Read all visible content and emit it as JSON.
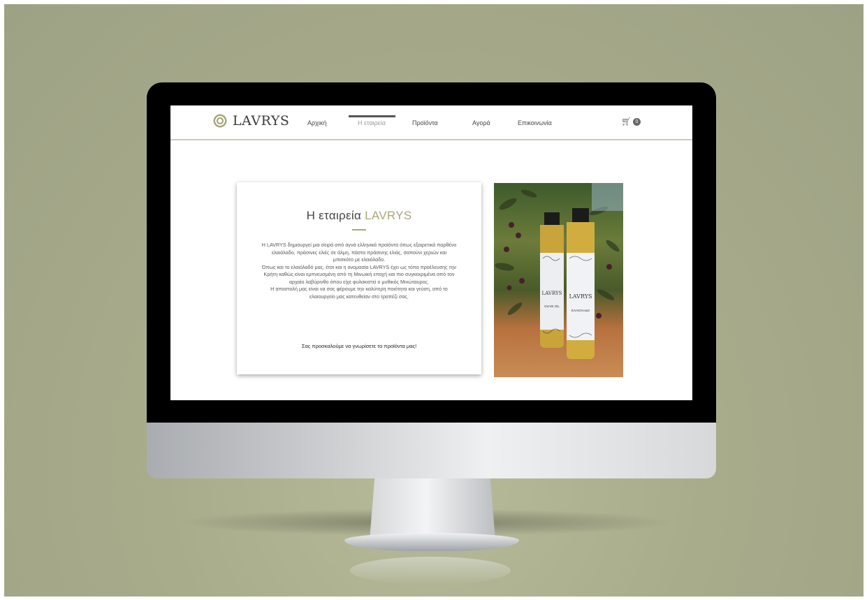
{
  "site": {
    "logo_text": "LAVRYS",
    "nav": [
      {
        "label": "Αρχική"
      },
      {
        "label": "Η εταιρεία"
      },
      {
        "label": "Προϊόντα"
      },
      {
        "label": "Αγορά"
      },
      {
        "label": "Επικοινωνία"
      }
    ],
    "active_nav_index": 1,
    "cart": {
      "icon": "cart-icon",
      "count": "0"
    }
  },
  "about": {
    "title": "Η εταιρεία",
    "title_accent": "LAVRYS",
    "paragraphs": [
      "Η LAVRYS δημιουργεί μια σειρά από αγνά ελληνικά προϊόντα όπως εξαιρετικά παρθένο ελαιόλαδο, πράσινες ελιές σε άλμη, πάστα πράσινης ελιάς, σαπούνι χεριών και μπισκότο με ελαιόλαδο.",
      "Όπως και το ελαιόλαδό μας, έτσι και η ονομασία LAVRYS έχει ως τόπο προέλευσης την Κρήτη καθώς είναι εμπνευσμένη από τη Μινωική εποχή και πιο συγκεκριμένα από τον αρχαίο λαβύρινθο όπου είχε φυλακιστεί ο μυθικός Μινώταυρος.",
      "Η αποστολή μας είναι να σας φέρουμε την καλύτερη ποιότητα και γεύση, από το ελαιουργείο μας κατευθείαν στο τραπέζι σας."
    ],
    "cta": "Σας προσκαλούμε να γνωρίσετε τα προϊόντα μας!"
  },
  "photo": {
    "label_left": "LAVRYS",
    "label_right": "LAVRYS",
    "sub_left": "OLIVE OIL",
    "sub_right": "ΕΛΑΙΟΛΑΔΟ"
  },
  "colors": {
    "accent": "#a9a77a",
    "background": "#a3a788"
  }
}
